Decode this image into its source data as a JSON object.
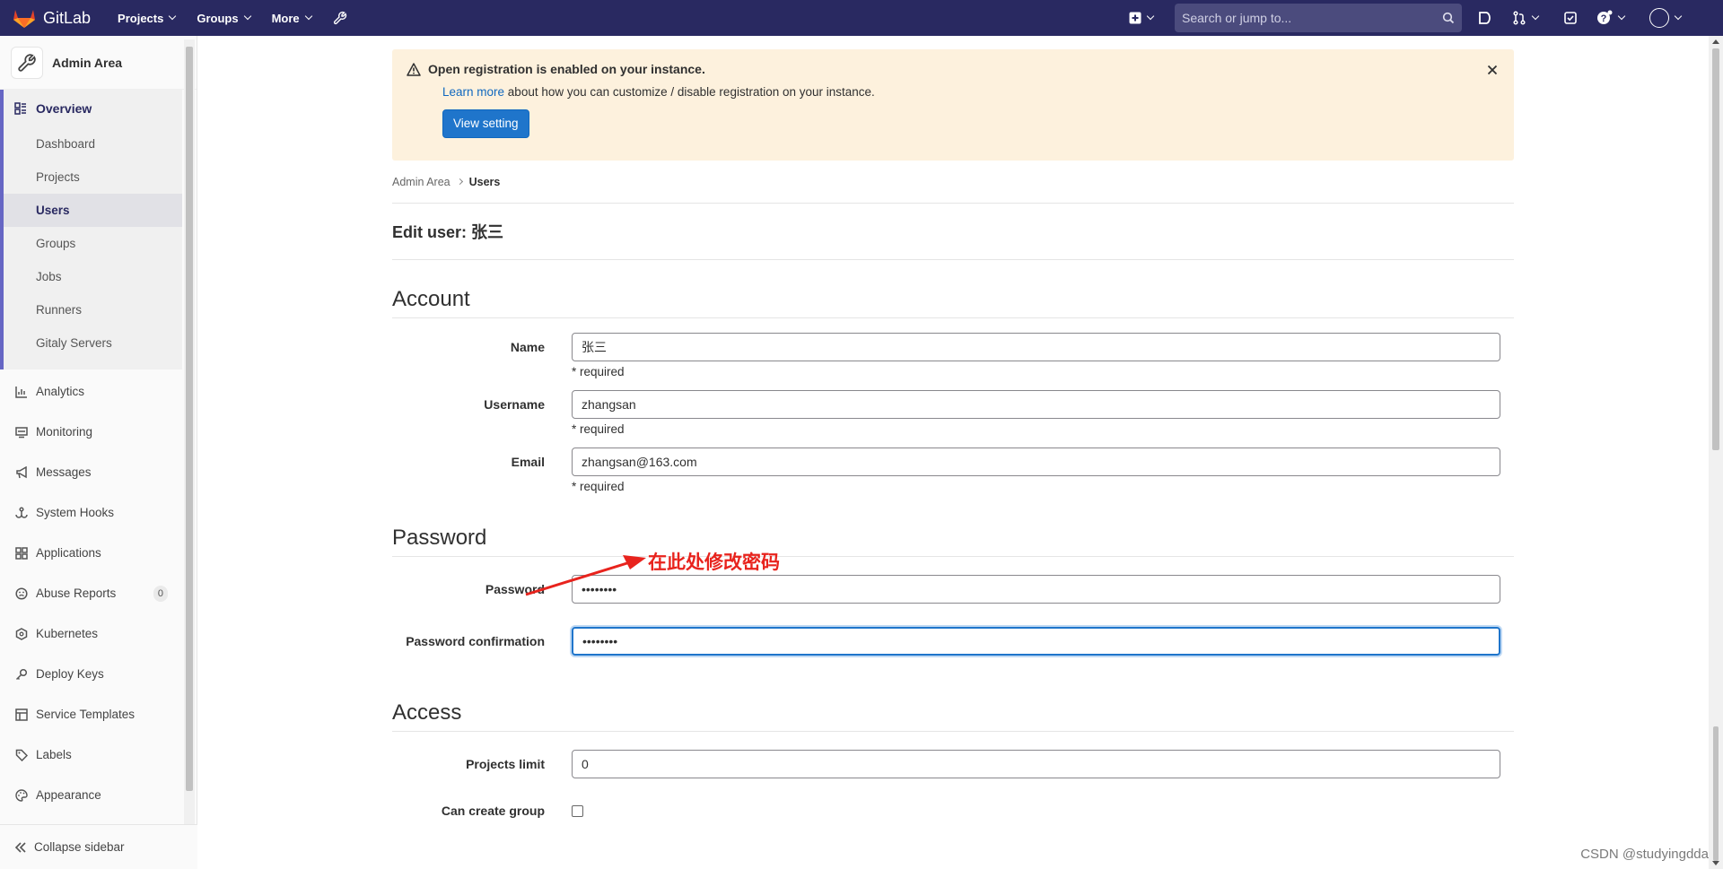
{
  "navbar": {
    "brand": "GitLab",
    "menu": [
      {
        "label": "Projects"
      },
      {
        "label": "Groups"
      },
      {
        "label": "More"
      }
    ],
    "search_placeholder": "Search or jump to...",
    "accent": "#292961"
  },
  "sidebar": {
    "title": "Admin Area",
    "overview": {
      "label": "Overview",
      "items": [
        {
          "label": "Dashboard"
        },
        {
          "label": "Projects"
        },
        {
          "label": "Users"
        },
        {
          "label": "Groups"
        },
        {
          "label": "Jobs"
        },
        {
          "label": "Runners"
        },
        {
          "label": "Gitaly Servers"
        }
      ]
    },
    "items": [
      {
        "label": "Analytics",
        "icon": "chart-icon"
      },
      {
        "label": "Monitoring",
        "icon": "monitor-icon"
      },
      {
        "label": "Messages",
        "icon": "bullhorn-icon"
      },
      {
        "label": "System Hooks",
        "icon": "hook-icon"
      },
      {
        "label": "Applications",
        "icon": "grid-icon"
      },
      {
        "label": "Abuse Reports",
        "icon": "emoji-icon",
        "badge": "0"
      },
      {
        "label": "Kubernetes",
        "icon": "kubernetes-icon"
      },
      {
        "label": "Deploy Keys",
        "icon": "key-icon"
      },
      {
        "label": "Service Templates",
        "icon": "template-icon"
      },
      {
        "label": "Labels",
        "icon": "tag-icon"
      },
      {
        "label": "Appearance",
        "icon": "palette-icon"
      }
    ],
    "collapse_label": "Collapse sidebar"
  },
  "alert": {
    "title": "Open registration is enabled on your instance.",
    "link_text": "Learn more",
    "body_text": " about how you can customize / disable registration on your instance.",
    "button_label": "View setting"
  },
  "breadcrumb": {
    "root": "Admin Area",
    "current": "Users"
  },
  "page_title": "Edit user: 张三",
  "account": {
    "title": "Account",
    "name_label": "Name",
    "name_value": "张三",
    "username_label": "Username",
    "username_value": "zhangsan",
    "email_label": "Email",
    "email_value": "zhangsan@163.com",
    "required_text": "* required"
  },
  "password": {
    "title": "Password",
    "password_label": "Password",
    "password_value": "••••••••",
    "confirmation_label": "Password confirmation",
    "confirmation_value": "••••••••",
    "annotation": "在此处修改密码",
    "annotation_color": "#e8231d"
  },
  "access": {
    "title": "Access",
    "projects_limit_label": "Projects limit",
    "projects_limit_value": "0",
    "can_create_group_label": "Can create group"
  },
  "watermark": "CSDN @studyingdda"
}
